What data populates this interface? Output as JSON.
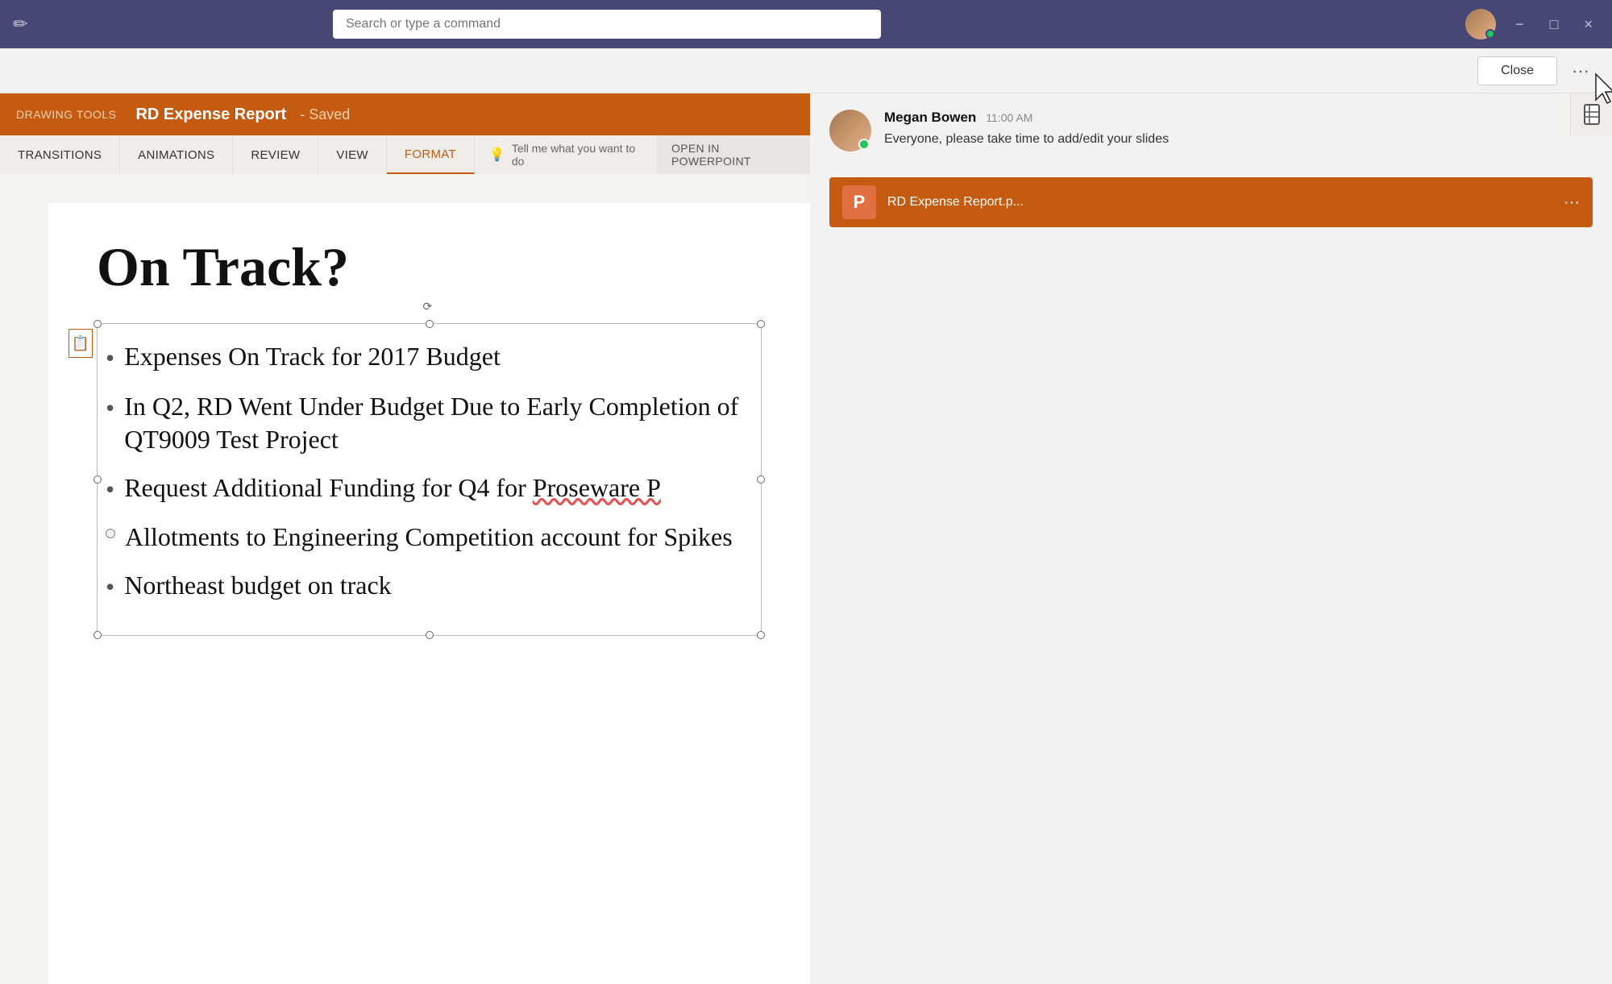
{
  "titleBar": {
    "searchPlaceholder": "Search or type a command",
    "minimizeLabel": "−",
    "maximizeLabel": "□",
    "closeLabel": "×",
    "editIconSymbol": "✏"
  },
  "tabBar": {
    "closeButton": "Close",
    "moreButton": "···"
  },
  "ribbon": {
    "drawingToolsLabel": "DRAWING TOOLS",
    "fileTitle": "RD Expense Report",
    "savedLabel": "Saved",
    "tabs": [
      {
        "id": "transitions",
        "label": "TRANSITIONS"
      },
      {
        "id": "animations",
        "label": "ANIMATIONS"
      },
      {
        "id": "review",
        "label": "REVIEW"
      },
      {
        "id": "view",
        "label": "VIEW"
      },
      {
        "id": "format",
        "label": "FORMAT",
        "active": true
      }
    ],
    "tellMeLabel": "Tell me what you want to do",
    "openInPowerPoint": "OPEN IN POWERPOINT"
  },
  "slide": {
    "title": "On Track?",
    "bullets": [
      {
        "text": "Expenses On Track for 2017 Budget",
        "type": "bullet"
      },
      {
        "text": "In Q2, RD Went Under Budget Due to Early Completion of QT9009 Test Project",
        "type": "bullet"
      },
      {
        "text": "Request Additional Funding for Q4 for Proseware P",
        "type": "bullet",
        "hasUnderline": true,
        "underlineStart": "Proseware"
      },
      {
        "text": "Allotments to Engineering Competition account for Spikes",
        "type": "circle"
      },
      {
        "text": "Northeast budget on track",
        "type": "bullet"
      }
    ]
  },
  "chat": {
    "senderName": "Megan Bowen",
    "timestamp": "11:00 AM",
    "message": "Everyone, please take time to add/edit your slides",
    "fileAttachment": {
      "name": "RD Expense Report.p...",
      "iconLabel": "P"
    }
  },
  "colors": {
    "orange": "#c55a11",
    "lightOrange": "#e07040",
    "teamsPurple": "#464775",
    "green": "#22c55e"
  }
}
